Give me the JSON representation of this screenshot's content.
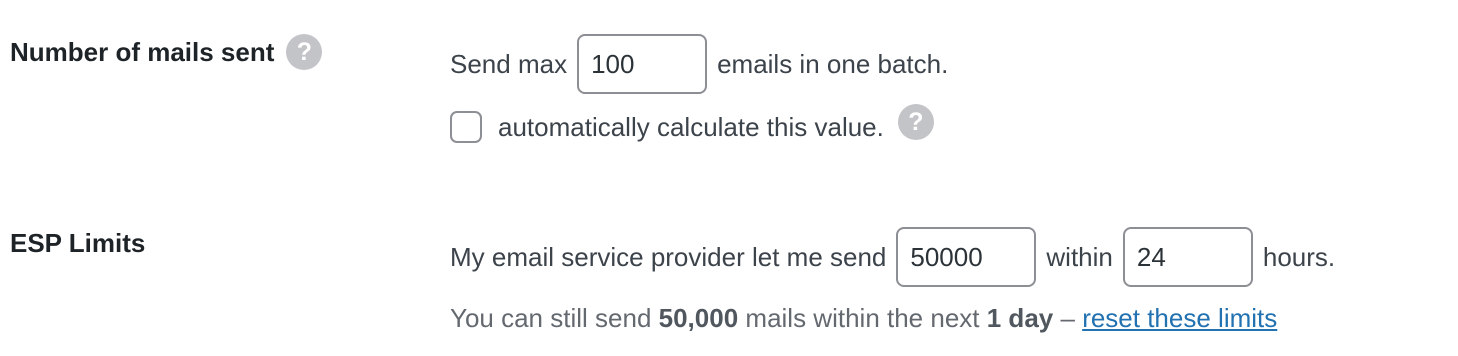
{
  "batch": {
    "label": "Number of mails sent",
    "help_icon": "?",
    "send_prefix": "Send max",
    "batch_value": "100",
    "send_suffix": "emails in one batch.",
    "auto_label": "automatically calculate this value.",
    "auto_checked": false,
    "auto_help_icon": "?"
  },
  "esp": {
    "label": "ESP Limits",
    "limit_prefix": "My email service provider let me send",
    "limit_value": "50000",
    "within_label": "within",
    "hours_value": "24",
    "hours_label": "hours.",
    "info": {
      "prefix": "You can still send",
      "count": "50,000",
      "middle": "mails within the next",
      "period": "1 day",
      "dash": "–",
      "reset_link": "reset these limits"
    }
  },
  "colors": {
    "link": "#2271b1",
    "label": "#1d2327",
    "text": "#3c434a",
    "help_icon_bg": "#c3c4c7"
  }
}
